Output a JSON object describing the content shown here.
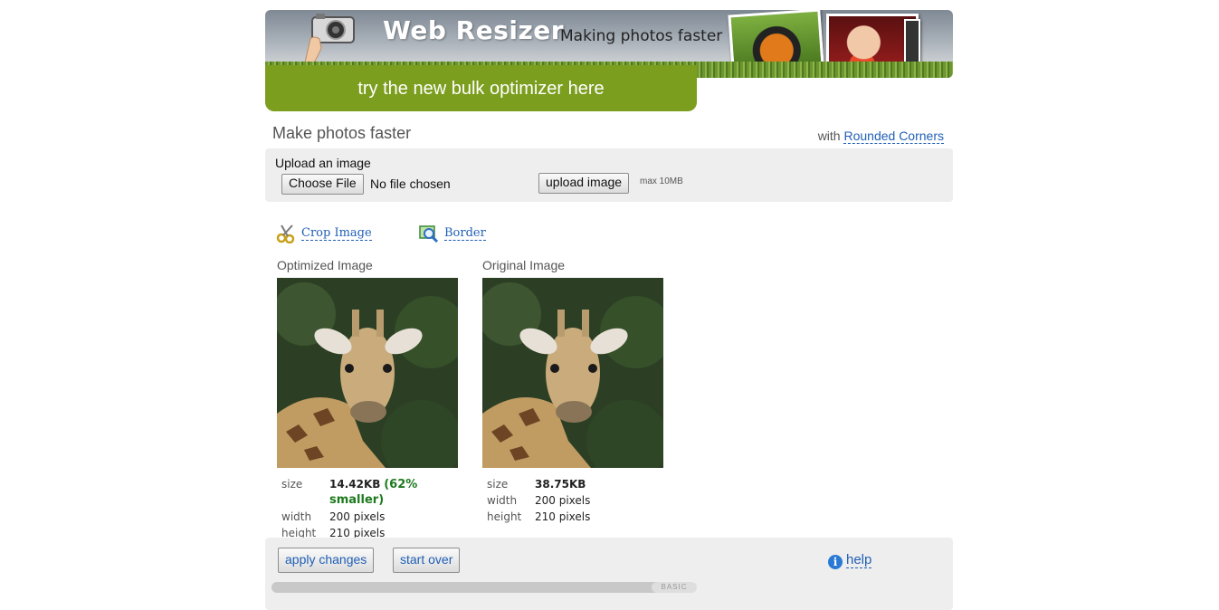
{
  "header": {
    "logo_text": "Web Resizer",
    "tagline": "Making photos faster",
    "bulk_link": "try the new bulk optimizer here"
  },
  "page": {
    "heading": "Make photos faster",
    "with_prefix": "with",
    "rounded_corners_link": "Rounded Corners"
  },
  "upload": {
    "label": "Upload an image",
    "choose_file": "Choose File",
    "no_file": "No file chosen",
    "upload_button": "upload image",
    "max_size": "max 10MB"
  },
  "tools": {
    "crop": "Crop Image",
    "border": "Border"
  },
  "optimized": {
    "title": "Optimized Image",
    "size_label": "size",
    "size_value": "14.42KB",
    "size_note": "(62% smaller)",
    "width_label": "width",
    "width_value": "200 pixels",
    "height_label": "height",
    "height_value": "210 pixels"
  },
  "original": {
    "title": "Original Image",
    "size_label": "size",
    "size_value": "38.75KB",
    "width_label": "width",
    "width_value": "200 pixels",
    "height_label": "height",
    "height_value": "210 pixels"
  },
  "actions": {
    "apply": "apply changes",
    "start_over": "start over",
    "help": "help",
    "slider_tab": "BASIC"
  },
  "colors": {
    "accent_green": "#7c9e1e",
    "link_blue": "#1f5fb5",
    "savings_green": "#1e7a1e"
  }
}
